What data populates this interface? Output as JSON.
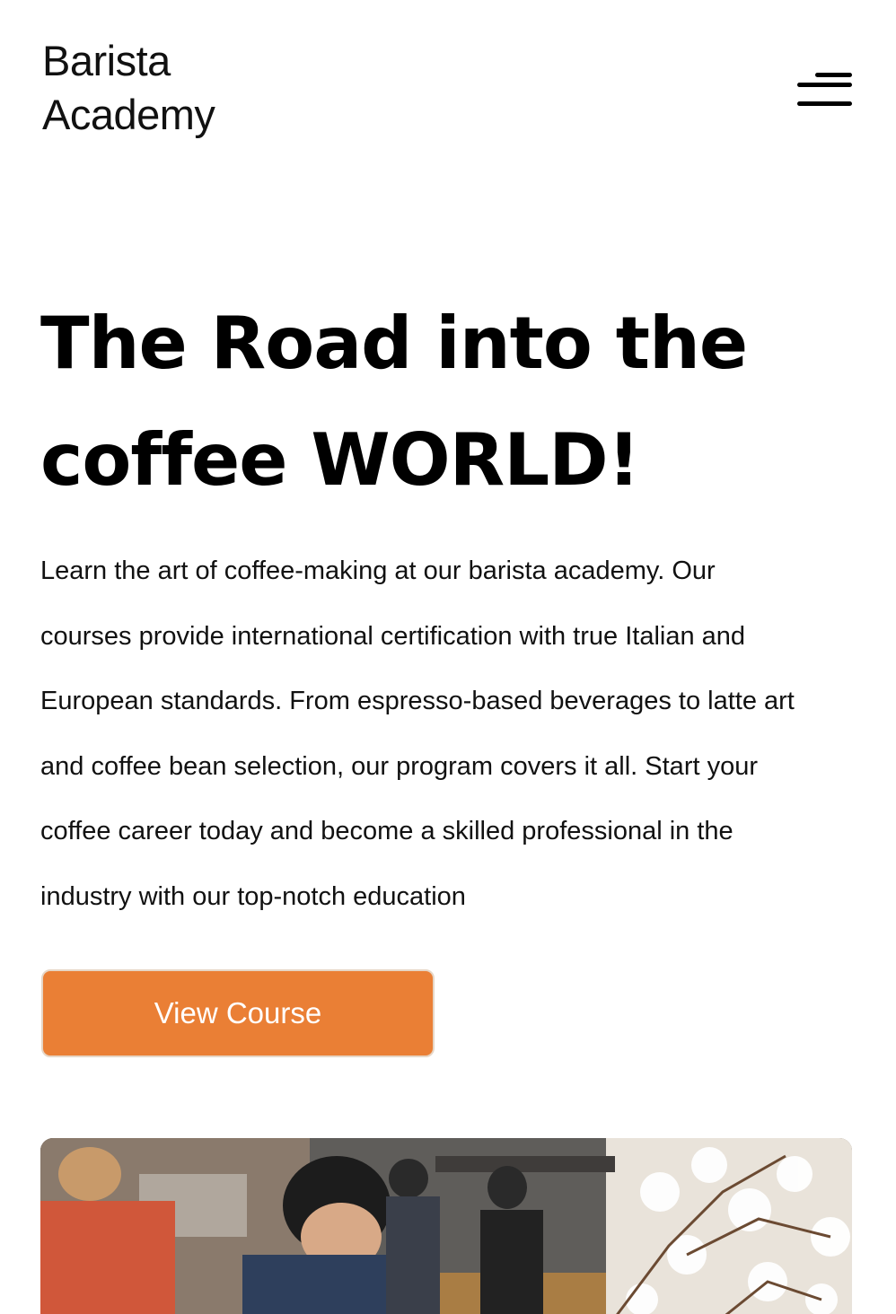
{
  "header": {
    "logo_line1": "Barista",
    "logo_line2": "Academy",
    "menu_icon": "hamburger-menu-icon"
  },
  "hero": {
    "title_line1": "The Road into the",
    "title_line2": "coffee WORLD!",
    "description_lines": [
      "Learn the art of coffee-making at our barista academy. Our",
      "courses provide international certification with true Italian and",
      "European standards. From espresso-based beverages to latte art",
      "and coffee bean selection, our program covers it all. Start your",
      "coffee career today and become a skilled professional in the",
      "industry with our top-notch education"
    ],
    "cta_label": "View Course",
    "image_alt": "baristas-working-in-cafe-photo"
  },
  "colors": {
    "accent": "#ea7f35",
    "text": "#000000",
    "background": "#ffffff"
  }
}
